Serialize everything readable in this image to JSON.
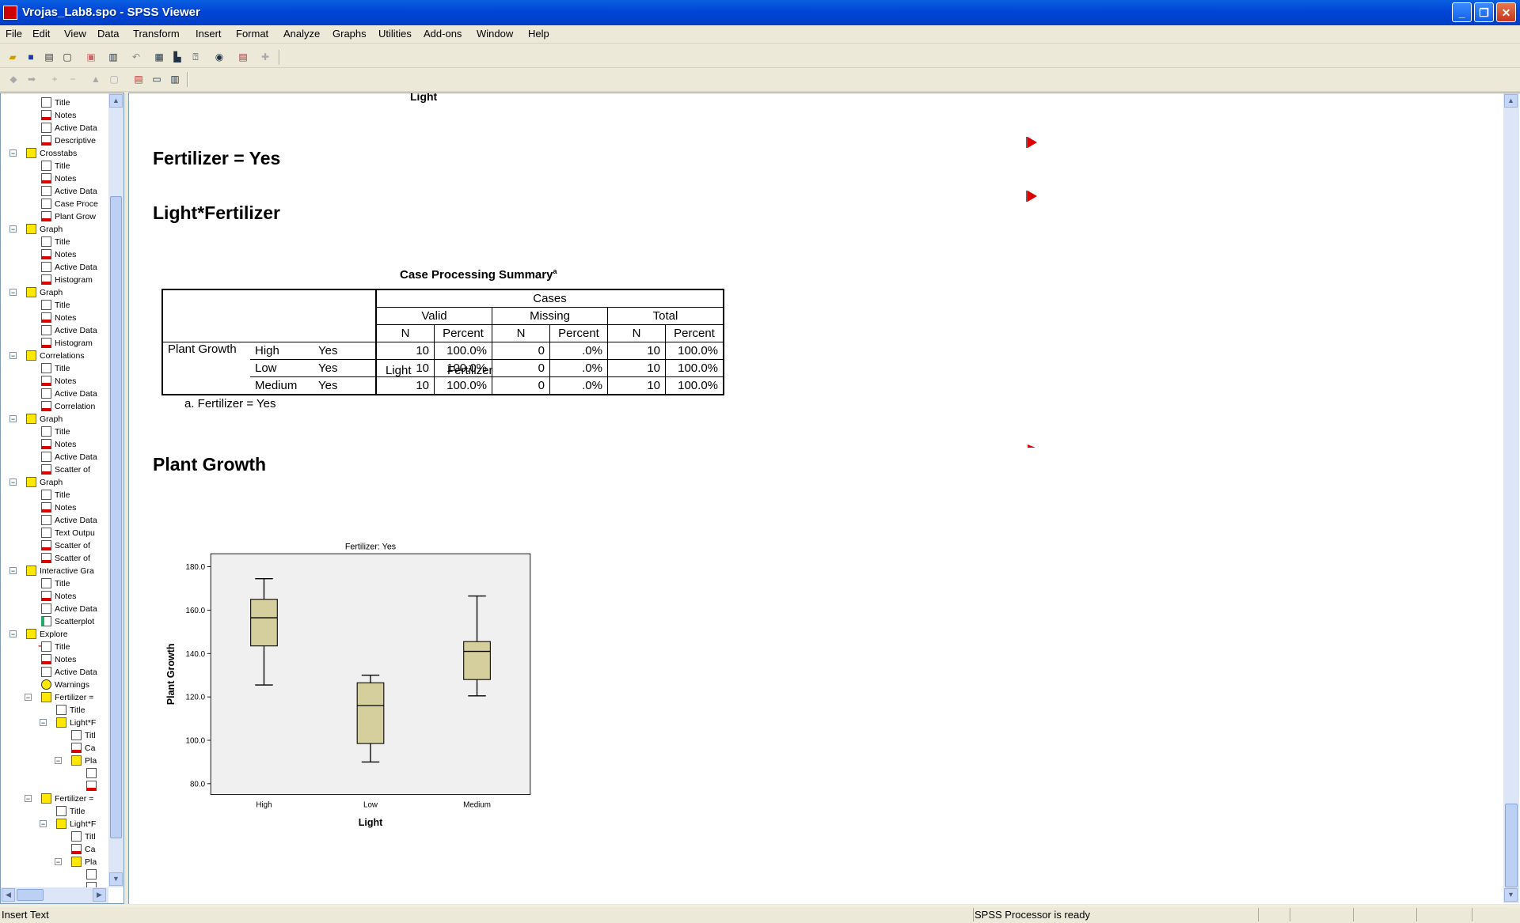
{
  "window": {
    "title": "Vrojas_Lab8.spo - SPSS Viewer",
    "minimize": "_",
    "restore": "❐",
    "close": "✕"
  },
  "menu": [
    "File",
    "Edit",
    "View",
    "Data",
    "Transform",
    "Insert",
    "Format",
    "Analyze",
    "Graphs",
    "Utilities",
    "Add-ons",
    "Window",
    "Help"
  ],
  "outline": [
    {
      "label": "Title",
      "indent": 3,
      "icon": "page"
    },
    {
      "label": "Notes",
      "indent": 3,
      "icon": "red"
    },
    {
      "label": "Active Data",
      "indent": 3,
      "icon": "page"
    },
    {
      "label": "Descriptive",
      "indent": 3,
      "icon": "red"
    },
    {
      "label": "Crosstabs",
      "indent": 2,
      "icon": "book",
      "expander": "−"
    },
    {
      "label": "Title",
      "indent": 3,
      "icon": "page"
    },
    {
      "label": "Notes",
      "indent": 3,
      "icon": "red"
    },
    {
      "label": "Active Data",
      "indent": 3,
      "icon": "page"
    },
    {
      "label": "Case Proce",
      "indent": 3,
      "icon": "page"
    },
    {
      "label": "Plant Grow",
      "indent": 3,
      "icon": "red"
    },
    {
      "label": "Graph",
      "indent": 2,
      "icon": "book",
      "expander": "−"
    },
    {
      "label": "Title",
      "indent": 3,
      "icon": "page"
    },
    {
      "label": "Notes",
      "indent": 3,
      "icon": "red"
    },
    {
      "label": "Active Data",
      "indent": 3,
      "icon": "page"
    },
    {
      "label": "Histogram",
      "indent": 3,
      "icon": "red"
    },
    {
      "label": "Graph",
      "indent": 2,
      "icon": "book",
      "expander": "−"
    },
    {
      "label": "Title",
      "indent": 3,
      "icon": "page"
    },
    {
      "label": "Notes",
      "indent": 3,
      "icon": "red"
    },
    {
      "label": "Active Data",
      "indent": 3,
      "icon": "page"
    },
    {
      "label": "Histogram",
      "indent": 3,
      "icon": "red"
    },
    {
      "label": "Correlations",
      "indent": 2,
      "icon": "book",
      "expander": "−"
    },
    {
      "label": "Title",
      "indent": 3,
      "icon": "page"
    },
    {
      "label": "Notes",
      "indent": 3,
      "icon": "red"
    },
    {
      "label": "Active Data",
      "indent": 3,
      "icon": "page"
    },
    {
      "label": "Correlation",
      "indent": 3,
      "icon": "red"
    },
    {
      "label": "Graph",
      "indent": 2,
      "icon": "book",
      "expander": "−"
    },
    {
      "label": "Title",
      "indent": 3,
      "icon": "page"
    },
    {
      "label": "Notes",
      "indent": 3,
      "icon": "red"
    },
    {
      "label": "Active Data",
      "indent": 3,
      "icon": "page"
    },
    {
      "label": "Scatter of",
      "indent": 3,
      "icon": "red"
    },
    {
      "label": "Graph",
      "indent": 2,
      "icon": "book",
      "expander": "−"
    },
    {
      "label": "Title",
      "indent": 3,
      "icon": "page"
    },
    {
      "label": "Notes",
      "indent": 3,
      "icon": "red"
    },
    {
      "label": "Active Data",
      "indent": 3,
      "icon": "page"
    },
    {
      "label": "Text Outpu",
      "indent": 3,
      "icon": "page"
    },
    {
      "label": "Scatter of",
      "indent": 3,
      "icon": "red"
    },
    {
      "label": "Scatter of",
      "indent": 3,
      "icon": "red"
    },
    {
      "label": "Interactive Gra",
      "indent": 2,
      "icon": "book",
      "expander": "−"
    },
    {
      "label": "Title",
      "indent": 3,
      "icon": "page"
    },
    {
      "label": "Notes",
      "indent": 3,
      "icon": "red"
    },
    {
      "label": "Active Data",
      "indent": 3,
      "icon": "page"
    },
    {
      "label": "Scatterplot",
      "indent": 3,
      "icon": "scat"
    },
    {
      "label": "Explore",
      "indent": 2,
      "icon": "book",
      "expander": "−"
    },
    {
      "label": "Title",
      "indent": 3,
      "icon": "page",
      "current": true
    },
    {
      "label": "Notes",
      "indent": 3,
      "icon": "red"
    },
    {
      "label": "Active Data",
      "indent": 3,
      "icon": "page"
    },
    {
      "label": "Warnings",
      "indent": 3,
      "icon": "warn"
    },
    {
      "label": "Fertilizer =",
      "indent": 3,
      "icon": "book",
      "expander": "−"
    },
    {
      "label": "Title",
      "indent": 4,
      "icon": "page"
    },
    {
      "label": "Light*F",
      "indent": 4,
      "icon": "book",
      "expander": "−"
    },
    {
      "label": "Titl",
      "indent": 5,
      "icon": "page"
    },
    {
      "label": "Ca",
      "indent": 5,
      "icon": "red"
    },
    {
      "label": "Pla",
      "indent": 5,
      "icon": "book",
      "expander": "−"
    },
    {
      "label": "",
      "indent": 6,
      "icon": "page"
    },
    {
      "label": "",
      "indent": 6,
      "icon": "red"
    },
    {
      "label": "Fertilizer =",
      "indent": 3,
      "icon": "book",
      "expander": "−"
    },
    {
      "label": "Title",
      "indent": 4,
      "icon": "page"
    },
    {
      "label": "Light*F",
      "indent": 4,
      "icon": "book",
      "expander": "−"
    },
    {
      "label": "Titl",
      "indent": 5,
      "icon": "page"
    },
    {
      "label": "Ca",
      "indent": 5,
      "icon": "red"
    },
    {
      "label": "Pla",
      "indent": 5,
      "icon": "book",
      "expander": "−"
    },
    {
      "label": "",
      "indent": 6,
      "icon": "page"
    },
    {
      "label": "",
      "indent": 6,
      "icon": "page"
    }
  ],
  "viewer": {
    "top_fragment": "Light",
    "heading1": "Fertilizer = Yes",
    "heading2": "Light*Fertilizer",
    "heading3": "Plant Growth",
    "table": {
      "title": "Case Processing Summary",
      "title_sup": "a",
      "cases": "Cases",
      "groups": [
        "Valid",
        "Missing",
        "Total"
      ],
      "cols": [
        "N",
        "Percent",
        "N",
        "Percent",
        "N",
        "Percent"
      ],
      "row_var_headers": [
        "Light",
        "Fertilizer"
      ],
      "dependent": "Plant Growth",
      "rows": [
        {
          "light": "High",
          "fert": "Yes",
          "cells": [
            "10",
            "100.0%",
            "0",
            ".0%",
            "10",
            "100.0%"
          ]
        },
        {
          "light": "Low",
          "fert": "Yes",
          "cells": [
            "10",
            "100.0%",
            "0",
            ".0%",
            "10",
            "100.0%"
          ]
        },
        {
          "light": "Medium",
          "fert": "Yes",
          "cells": [
            "10",
            "100.0%",
            "0",
            ".0%",
            "10",
            "100.0%"
          ]
        }
      ],
      "footnote": "a. Fertilizer = Yes"
    }
  },
  "chart_data": {
    "type": "boxplot",
    "title": "Fertilizer: Yes",
    "xlabel": "Light",
    "ylabel": "Plant Growth",
    "ylim": [
      75,
      186
    ],
    "yticks": [
      "80.0",
      "100.0",
      "120.0",
      "140.0",
      "160.0",
      "180.0"
    ],
    "ytick_values": [
      80,
      100,
      120,
      140,
      160,
      180
    ],
    "box_color": "#d5cf9e",
    "plot_bg": "#f0f0f0",
    "categories": [
      "High",
      "Low",
      "Medium"
    ],
    "boxes": [
      {
        "name": "High",
        "min": 125.5,
        "q1": 143.5,
        "median": 156.5,
        "q3": 165,
        "max": 174.5
      },
      {
        "name": "Low",
        "min": 90,
        "q1": 98.5,
        "median": 116,
        "q3": 126.5,
        "max": 130
      },
      {
        "name": "Medium",
        "min": 120.5,
        "q1": 128,
        "median": 141,
        "q3": 145.5,
        "max": 166.5
      }
    ]
  },
  "status": {
    "left": "Insert Text",
    "right": "SPSS Processor  is ready"
  }
}
